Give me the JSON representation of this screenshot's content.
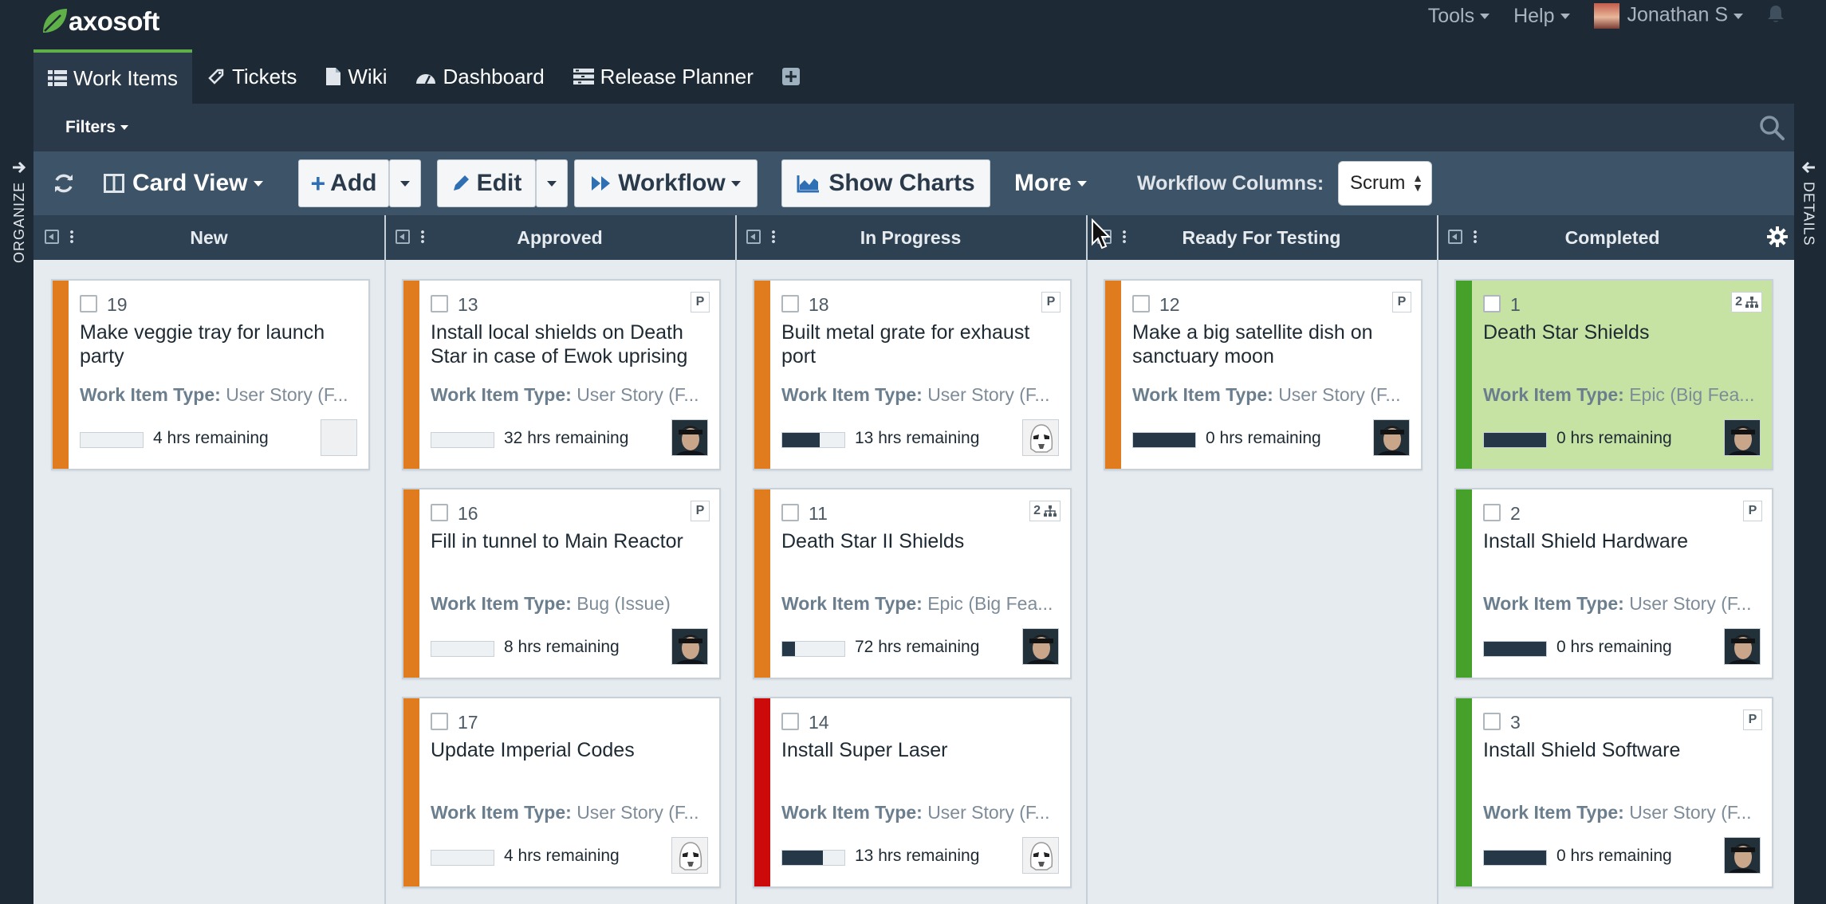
{
  "app": {
    "logo_text": "axosoft"
  },
  "header": {
    "tools_label": "Tools",
    "help_label": "Help",
    "user_name": "Jonathan S"
  },
  "tabs": [
    {
      "label": "Work Items",
      "icon": "list-icon",
      "active": true
    },
    {
      "label": "Tickets",
      "icon": "ticket-icon",
      "active": false
    },
    {
      "label": "Wiki",
      "icon": "document-icon",
      "active": false
    },
    {
      "label": "Dashboard",
      "icon": "gauge-icon",
      "active": false
    },
    {
      "label": "Release Planner",
      "icon": "planner-icon",
      "active": false
    }
  ],
  "filters": {
    "label": "Filters"
  },
  "toolbar": {
    "card_view_label": "Card View",
    "add_label": "Add",
    "edit_label": "Edit",
    "workflow_label": "Workflow",
    "show_charts_label": "Show Charts",
    "more_label": "More",
    "workflow_columns_label": "Workflow Columns:",
    "workflow_columns_value": "Scrum"
  },
  "side": {
    "left_label": "ORGANIZE",
    "right_label": "DETAILS"
  },
  "columns": [
    {
      "name": "New"
    },
    {
      "name": "Approved"
    },
    {
      "name": "In Progress"
    },
    {
      "name": "Ready For Testing"
    },
    {
      "name": "Completed"
    }
  ],
  "colors": {
    "stripe_orange": "#e07b1e",
    "stripe_green": "#46a12a",
    "stripe_red": "#cc0a0a",
    "card_green_bg": "#c7e3a4",
    "accent_green": "#5fb049",
    "header_bg": "#1d2a36"
  },
  "cards": [
    {
      "id": "19",
      "title": "Make veggie tray for launch party",
      "type_label": "Work Item Type:",
      "type_value": "User Story (F...",
      "remaining": "4 hrs remaining",
      "progress": 0,
      "badge": "",
      "avatar": "none",
      "stripe": "orange",
      "bg": "white"
    },
    {
      "id": "13",
      "title": "Install local shields on Death Star in case of Ewok uprising",
      "type_label": "Work Item Type:",
      "type_value": "User Story (F...",
      "remaining": "32 hrs remaining",
      "progress": 0,
      "badge": "P",
      "avatar": "person",
      "stripe": "orange",
      "bg": "white"
    },
    {
      "id": "16",
      "title": "Fill in tunnel to Main Reactor",
      "type_label": "Work Item Type:",
      "type_value": "Bug (Issue)",
      "remaining": "8 hrs remaining",
      "progress": 0,
      "badge": "P",
      "avatar": "person",
      "stripe": "orange",
      "bg": "white"
    },
    {
      "id": "17",
      "title": "Update Imperial Codes",
      "type_label": "Work Item Type:",
      "type_value": "User Story (F...",
      "remaining": "4 hrs remaining",
      "progress": 0,
      "badge": "",
      "avatar": "trooper",
      "stripe": "orange",
      "bg": "white"
    },
    {
      "id": "18",
      "title": "Built metal grate for exhaust port",
      "type_label": "Work Item Type:",
      "type_value": "User Story (F...",
      "remaining": "13 hrs remaining",
      "progress": 0.6,
      "badge": "P",
      "avatar": "trooper",
      "stripe": "orange",
      "bg": "white"
    },
    {
      "id": "11",
      "title": "Death Star II Shields",
      "type_label": "Work Item Type:",
      "type_value": "Epic (Big Fea...",
      "remaining": "72 hrs remaining",
      "progress": 0.2,
      "badge": "2",
      "avatar": "person",
      "stripe": "orange",
      "bg": "white"
    },
    {
      "id": "14",
      "title": "Install Super Laser",
      "type_label": "Work Item Type:",
      "type_value": "User Story (F...",
      "remaining": "13 hrs remaining",
      "progress": 0.65,
      "badge": "",
      "avatar": "trooper",
      "stripe": "red",
      "bg": "white"
    },
    {
      "id": "12",
      "title": "Make a big satellite dish on sanctuary moon",
      "type_label": "Work Item Type:",
      "type_value": "User Story (F...",
      "remaining": "0 hrs remaining",
      "progress": 1,
      "badge": "P",
      "avatar": "person",
      "stripe": "orange",
      "bg": "white"
    },
    {
      "id": "1",
      "title": "Death Star Shields",
      "type_label": "Work Item Type:",
      "type_value": "Epic (Big Fea...",
      "remaining": "0 hrs remaining",
      "progress": 1,
      "badge": "2",
      "avatar": "person",
      "stripe": "green",
      "bg": "green"
    },
    {
      "id": "2",
      "title": "Install Shield Hardware",
      "type_label": "Work Item Type:",
      "type_value": "User Story (F...",
      "remaining": "0 hrs remaining",
      "progress": 1,
      "badge": "P",
      "avatar": "person",
      "stripe": "green",
      "bg": "white"
    },
    {
      "id": "3",
      "title": "Install Shield Software",
      "type_label": "Work Item Type:",
      "type_value": "User Story (F...",
      "remaining": "0 hrs remaining",
      "progress": 1,
      "badge": "P",
      "avatar": "person",
      "stripe": "green",
      "bg": "white"
    }
  ]
}
